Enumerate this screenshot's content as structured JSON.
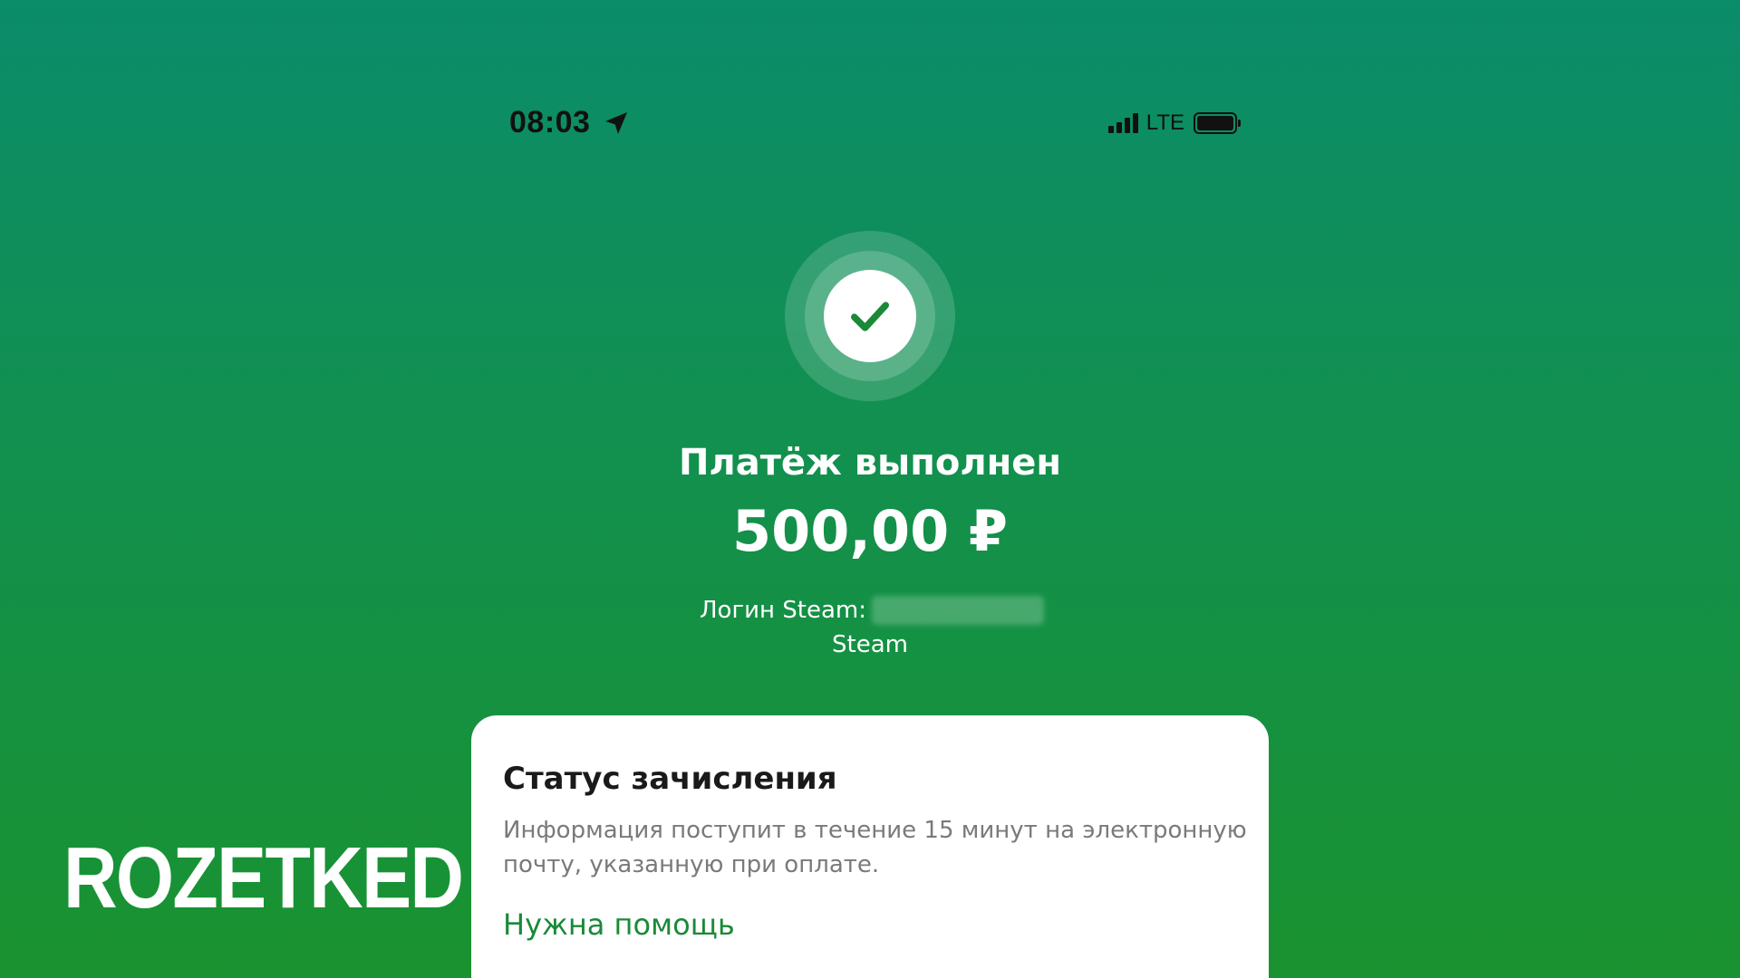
{
  "status_bar": {
    "time": "08:03",
    "location_icon": "location-arrow-icon",
    "signal_icon": "cellular-signal-icon",
    "network": "LTE",
    "battery_icon": "battery-full-icon"
  },
  "success_icon": "checkmark-icon",
  "payment": {
    "title": "Платёж выполнен",
    "amount": "500,00 ₽",
    "login_label": "Логин Steam:",
    "service": "Steam"
  },
  "status_card": {
    "title": "Статус зачисления",
    "description": "Информация поступит в течение 15 минут на электронную почту, указанную при оплате.",
    "help_link": "Нужна помощь"
  },
  "watermark": "ROZETKED",
  "colors": {
    "background_top": "#0b8c6a",
    "background_bottom": "#1a9230",
    "accent_green": "#1a8a38",
    "card": "#ffffff",
    "muted_text": "#7a7a7a"
  }
}
